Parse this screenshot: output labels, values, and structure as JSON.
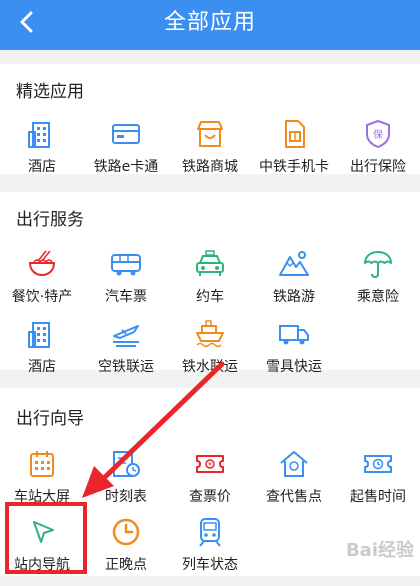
{
  "header": {
    "title": "全部应用",
    "back_icon": "chevron-left-icon"
  },
  "sections": [
    {
      "title": "精选应用",
      "items": [
        {
          "label": "酒店",
          "icon": "hotel-icon"
        },
        {
          "label": "铁路e卡通",
          "icon": "card-icon"
        },
        {
          "label": "铁路商城",
          "icon": "shop-icon"
        },
        {
          "label": "中铁手机卡",
          "icon": "sim-card-icon"
        },
        {
          "label": "出行保险",
          "icon": "insurance-icon"
        }
      ]
    },
    {
      "title": "出行服务",
      "items": [
        {
          "label": "餐饮·特产",
          "icon": "noodle-icon"
        },
        {
          "label": "汽车票",
          "icon": "bus-icon"
        },
        {
          "label": "约车",
          "icon": "taxi-icon"
        },
        {
          "label": "铁路游",
          "icon": "mountain-icon"
        },
        {
          "label": "乘意险",
          "icon": "umbrella-icon"
        },
        {
          "label": "酒店",
          "icon": "hotel-icon"
        },
        {
          "label": "空铁联运",
          "icon": "plane-icon"
        },
        {
          "label": "铁水联运",
          "icon": "ship-icon"
        },
        {
          "label": "雪具快运",
          "icon": "truck-icon"
        }
      ]
    },
    {
      "title": "出行向导",
      "items": [
        {
          "label": "车站大屏",
          "icon": "calendar-grid-icon"
        },
        {
          "label": "时刻表",
          "icon": "timetable-icon"
        },
        {
          "label": "查票价",
          "icon": "ticket-price-icon"
        },
        {
          "label": "查代售点",
          "icon": "home-ticket-icon"
        },
        {
          "label": "起售时间",
          "icon": "ticket-clock-icon"
        },
        {
          "label": "站内导航",
          "icon": "navigation-arrow-icon"
        },
        {
          "label": "正晚点",
          "icon": "clock-icon"
        },
        {
          "label": "列车状态",
          "icon": "train-icon"
        }
      ]
    }
  ],
  "watermark": "Bai经验",
  "colors": {
    "header": "#3b8ff0",
    "highlight": "#e8262c",
    "icon_blue": "#3b8ff0",
    "icon_orange": "#f08c1e",
    "icon_green": "#2db37b"
  }
}
